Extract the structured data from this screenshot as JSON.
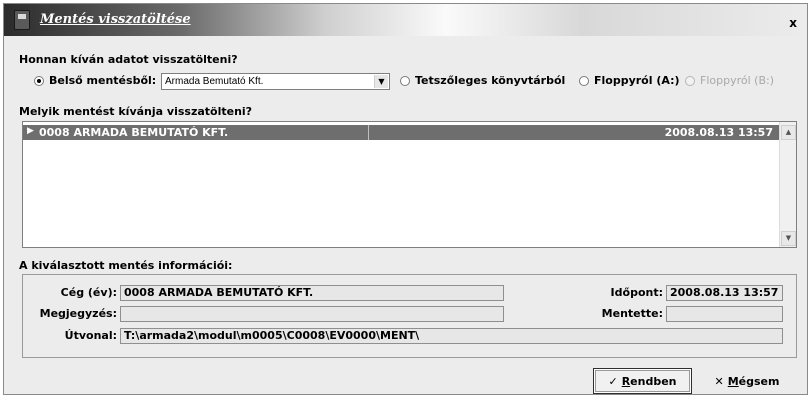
{
  "window": {
    "title": "Mentés visszatöltése",
    "close_label": "x"
  },
  "source": {
    "question": "Honnan kíván adatot visszatölteni?",
    "options": [
      {
        "label": "Belső mentésből:",
        "checked": true,
        "enabled": true
      },
      {
        "label": "Tetszőleges könyvtárból",
        "checked": false,
        "enabled": true
      },
      {
        "label": "Floppyról (A:)",
        "checked": false,
        "enabled": true
      },
      {
        "label": "Floppyról (B:)",
        "checked": false,
        "enabled": false
      }
    ],
    "combo_value": "Armada Bemutató Kft.",
    "combo_arrow": "▼"
  },
  "backups": {
    "question": "Melyik mentést kívánja visszatölteni?",
    "rows": [
      {
        "pointer": "▶",
        "name": "0008 ARMADA BEMUTATÓ KFT.",
        "time": "2008.08.13 13:57",
        "selected": true
      }
    ],
    "scroll_up": "▲",
    "scroll_down": "▼"
  },
  "info": {
    "heading": "A kiválasztott mentés információi:",
    "company_label": "Cég (év):",
    "company_value": "0008 ARMADA BEMUTATÓ KFT.",
    "time_label": "Időpont:",
    "time_value": "2008.08.13 13:57",
    "note_label": "Megjegyzés:",
    "note_value": "",
    "saver_label": "Mentette:",
    "saver_value": "",
    "path_label": "Útvonal:",
    "path_value": "T:\\armada2\\modul\\m0005\\C0008\\EV0000\\MENT\\"
  },
  "buttons": {
    "ok_icon": "✓",
    "ok_first": "R",
    "ok_rest": "endben",
    "cancel_icon": "✕",
    "cancel_first": "M",
    "cancel_rest": "égsem"
  }
}
